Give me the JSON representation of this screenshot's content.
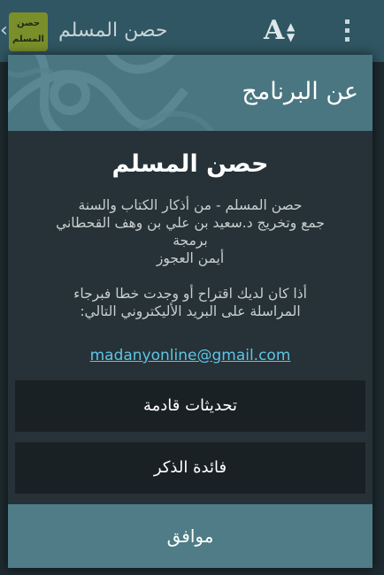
{
  "app_bar": {
    "title": "حصن المسلم",
    "logo_text_line1": "حصن",
    "logo_text_line2": "المسلم",
    "back_glyph": "‹",
    "font_size_icon": "font-size-icon",
    "menu_icon": "overflow-menu-icon"
  },
  "dialog": {
    "title": "عن البرنامج",
    "app_name": "حصن المسلم",
    "description": [
      "حصن المسلم - من أذكار الكتاب والسنة",
      "جمع وتخريج د.سعيد بن علي بن وهف القحطاني",
      "برمجة",
      "أيمن العجوز"
    ],
    "notice": [
      "أذا كان لديك اقتراح أو وجدت خطا فبرجاء",
      "المراسلة على البريد الأليكتروني التالي:"
    ],
    "email": "madanyonline@gmail.com",
    "buttons": {
      "upcoming_updates": "تحديثات قادمة",
      "dhikr_benefit": "فائدة الذكر"
    },
    "ok_button": "موافق"
  },
  "colors": {
    "header": "#4a7681",
    "footer": "#4f7c86",
    "dialog_bg": "#263237",
    "link": "#5fc3e6"
  }
}
